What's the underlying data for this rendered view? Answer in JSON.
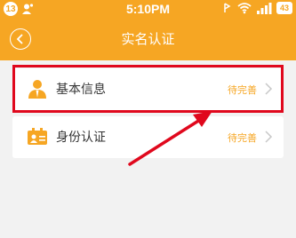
{
  "status_bar": {
    "notification_count": "13",
    "time": "5:10PM",
    "battery_level": "43"
  },
  "header": {
    "title": "实名认证"
  },
  "items": [
    {
      "label": "基本信息",
      "status": "待完善"
    },
    {
      "label": "身份认证",
      "status": "待完善"
    }
  ],
  "colors": {
    "accent": "#f6a623",
    "highlight": "#e0081d"
  },
  "icons": [
    "user-icon",
    "wifi-icon",
    "signal-icon",
    "battery-icon",
    "back-icon",
    "person-icon",
    "id-card-icon",
    "chevron-right-icon",
    "arrow-annotation"
  ]
}
